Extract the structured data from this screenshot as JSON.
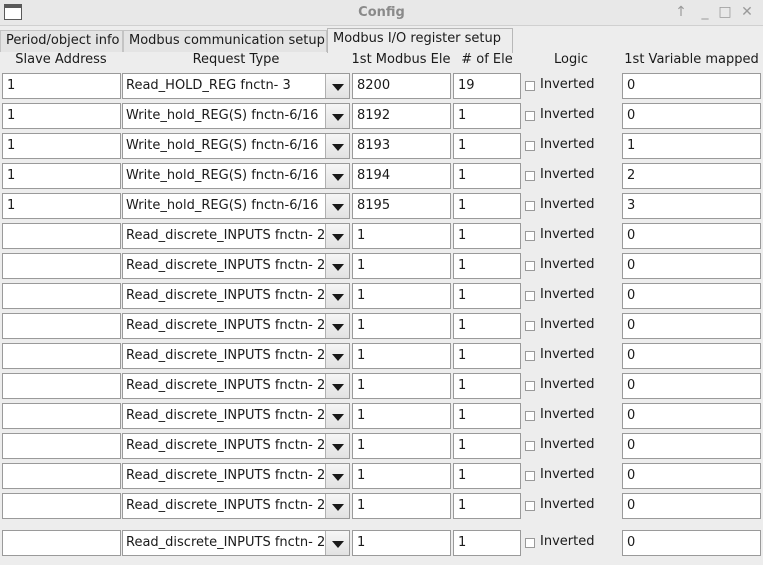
{
  "window": {
    "title": "Config",
    "controls": {
      "up": "↑",
      "minimize": "_",
      "maximize": "□",
      "close": "✕"
    }
  },
  "tabs": [
    {
      "label": "Period/object info",
      "active": false
    },
    {
      "label": "Modbus communication setup",
      "active": false
    },
    {
      "label": "Modbus  I/O register setup",
      "active": true
    }
  ],
  "headers": {
    "slave_address": "Slave Address",
    "request_type": "Request Type",
    "first_modbus_ele": "1st Modbus Ele",
    "num_ele": "# of Ele",
    "logic": "Logic",
    "first_variable": "1st Variable mapped"
  },
  "rows": [
    {
      "slave": "1",
      "request": "Read_HOLD_REG      fnctn- 3",
      "first_ele": "8200",
      "num": "19",
      "logic_label": "Inverted",
      "inverted": false,
      "variable": "0"
    },
    {
      "slave": "1",
      "request": "Write_hold_REG(S)     fnctn-6/16",
      "first_ele": "8192",
      "num": "1",
      "logic_label": "Inverted",
      "inverted": false,
      "variable": "0"
    },
    {
      "slave": "1",
      "request": "Write_hold_REG(S)     fnctn-6/16",
      "first_ele": "8193",
      "num": "1",
      "logic_label": "Inverted",
      "inverted": false,
      "variable": "1"
    },
    {
      "slave": "1",
      "request": "Write_hold_REG(S)     fnctn-6/16",
      "first_ele": "8194",
      "num": "1",
      "logic_label": "Inverted",
      "inverted": false,
      "variable": "2"
    },
    {
      "slave": "1",
      "request": "Write_hold_REG(S)     fnctn-6/16",
      "first_ele": "8195",
      "num": "1",
      "logic_label": "Inverted",
      "inverted": false,
      "variable": "3"
    },
    {
      "slave": "",
      "request": "Read_discrete_INPUTS  fnctn- 2",
      "first_ele": "1",
      "num": "1",
      "logic_label": "Inverted",
      "inverted": false,
      "variable": "0"
    },
    {
      "slave": "",
      "request": "Read_discrete_INPUTS  fnctn- 2",
      "first_ele": "1",
      "num": "1",
      "logic_label": "Inverted",
      "inverted": false,
      "variable": "0"
    },
    {
      "slave": "",
      "request": "Read_discrete_INPUTS  fnctn- 2",
      "first_ele": "1",
      "num": "1",
      "logic_label": "Inverted",
      "inverted": false,
      "variable": "0"
    },
    {
      "slave": "",
      "request": "Read_discrete_INPUTS  fnctn- 2",
      "first_ele": "1",
      "num": "1",
      "logic_label": "Inverted",
      "inverted": false,
      "variable": "0"
    },
    {
      "slave": "",
      "request": "Read_discrete_INPUTS  fnctn- 2",
      "first_ele": "1",
      "num": "1",
      "logic_label": "Inverted",
      "inverted": false,
      "variable": "0"
    },
    {
      "slave": "",
      "request": "Read_discrete_INPUTS  fnctn- 2",
      "first_ele": "1",
      "num": "1",
      "logic_label": "Inverted",
      "inverted": false,
      "variable": "0"
    },
    {
      "slave": "",
      "request": "Read_discrete_INPUTS  fnctn- 2",
      "first_ele": "1",
      "num": "1",
      "logic_label": "Inverted",
      "inverted": false,
      "variable": "0"
    },
    {
      "slave": "",
      "request": "Read_discrete_INPUTS  fnctn- 2",
      "first_ele": "1",
      "num": "1",
      "logic_label": "Inverted",
      "inverted": false,
      "variable": "0"
    },
    {
      "slave": "",
      "request": "Read_discrete_INPUTS  fnctn- 2",
      "first_ele": "1",
      "num": "1",
      "logic_label": "Inverted",
      "inverted": false,
      "variable": "0"
    },
    {
      "slave": "",
      "request": "Read_discrete_INPUTS  fnctn- 2",
      "first_ele": "1",
      "num": "1",
      "logic_label": "Inverted",
      "inverted": false,
      "variable": "0"
    },
    {
      "slave": "",
      "request": "Read_discrete_INPUTS  fnctn- 2",
      "first_ele": "1",
      "num": "1",
      "logic_label": "Inverted",
      "inverted": false,
      "variable": "0"
    }
  ]
}
